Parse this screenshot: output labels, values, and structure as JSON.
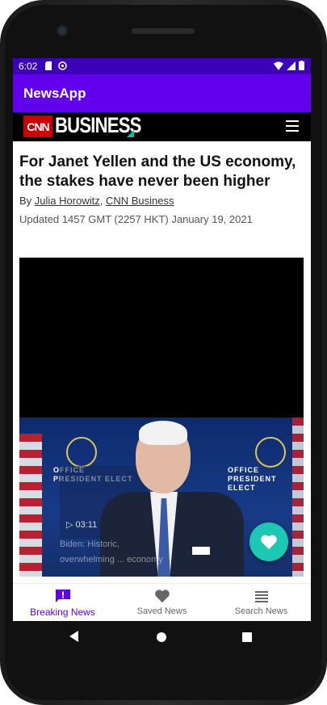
{
  "status_bar": {
    "time": "6:02"
  },
  "app_bar": {
    "title": "NewsApp"
  },
  "web_header": {
    "brand_logo": "CNN",
    "brand_section": "BUSINESS",
    "menu_icon": "hamburger-icon"
  },
  "article": {
    "headline": "For Janet Yellen and the US economy, the stakes have never been higher",
    "byline_prefix": "By ",
    "author": "Julia Horowitz",
    "byline_sep": ", ",
    "outlet": "CNN Business",
    "updated": "Updated 1457 GMT (2257 HKT) January 19, 2021",
    "video": {
      "backdrop_text_1": "OFFICE",
      "backdrop_text_2": "PRESIDENT ELECT",
      "inset_time": "03:11",
      "inset_caption": "Biden: Historic, overwhelming ... economy"
    }
  },
  "fab": {
    "icon": "heart-icon",
    "color": "#1cc7b4"
  },
  "bottom_nav": {
    "items": [
      {
        "label": "Breaking News",
        "icon": "alert-chat-icon",
        "active": true
      },
      {
        "label": "Saved News",
        "icon": "heart-icon",
        "active": false
      },
      {
        "label": "Search News",
        "icon": "list-icon",
        "active": false
      }
    ]
  },
  "colors": {
    "primary": "#6200ee",
    "status_bar": "#3b00b8",
    "accent": "#1cc7b4"
  }
}
